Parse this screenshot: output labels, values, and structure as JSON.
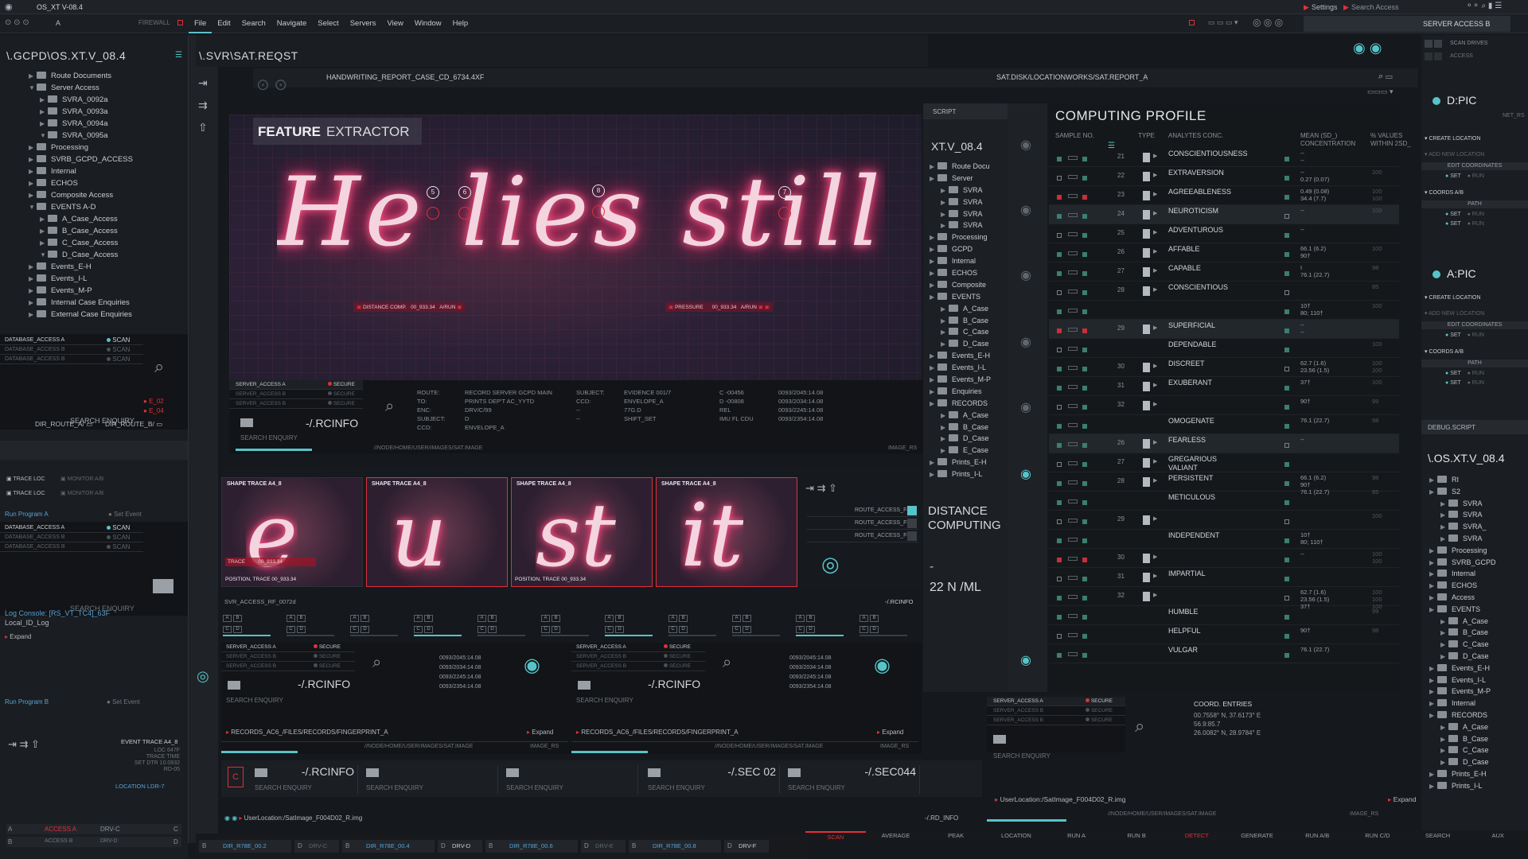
{
  "menubar": {
    "title": "OS_XT V-08.4",
    "firewall": "FIREWALL",
    "a_label": "A",
    "menus": [
      "File",
      "Edit",
      "Search",
      "Navigate",
      "Select",
      "Servers",
      "View",
      "Window",
      "Help"
    ],
    "settings": "Settings",
    "search_access": "Search Access",
    "server_access_b": "SERVER ACCESS B"
  },
  "left": {
    "path": "\\.GCPD\\OS.XT.V_08.4",
    "tree": [
      {
        "label": "Route Documents",
        "indent": 1,
        "open": false
      },
      {
        "label": "Server Access",
        "indent": 1,
        "open": true
      },
      {
        "label": "SVRA_0092a",
        "indent": 2,
        "open": false
      },
      {
        "label": "SVRA_0093a",
        "indent": 2,
        "open": false
      },
      {
        "label": "SVRA_0094a",
        "indent": 2,
        "open": false
      },
      {
        "label": "SVRA_0095a",
        "indent": 2,
        "open": true
      },
      {
        "label": "Processing",
        "indent": 1,
        "open": false
      },
      {
        "label": "SVRB_GCPD_ACCESS",
        "indent": 1,
        "open": false
      },
      {
        "label": "Internal",
        "indent": 1,
        "open": false
      },
      {
        "label": "ECHOS",
        "indent": 1,
        "open": false
      },
      {
        "label": "Composite Access",
        "indent": 1,
        "open": false
      },
      {
        "label": "EVENTS A-D",
        "indent": 1,
        "open": true
      },
      {
        "label": "A_Case_Access",
        "indent": 2,
        "open": false
      },
      {
        "label": "B_Case_Access",
        "indent": 2,
        "open": false
      },
      {
        "label": "C_Case_Access",
        "indent": 2,
        "open": false
      },
      {
        "label": "D_Case_Access",
        "indent": 2,
        "open": true
      },
      {
        "label": "Events_E-H",
        "indent": 1,
        "open": false
      },
      {
        "label": "Events_I-L",
        "indent": 1,
        "open": false
      },
      {
        "label": "Events_M-P",
        "indent": 1,
        "open": false
      },
      {
        "label": "Internal Case Enquiries",
        "indent": 1,
        "open": false
      },
      {
        "label": "External Case Enquiries",
        "indent": 1,
        "open": false
      }
    ],
    "db_rows": [
      "DATABASE_ACCESS A",
      "DATABASE_ACCESS B",
      "DATABASE_ACCESS B"
    ],
    "scan": "SCAN",
    "search_enquiry": "SEARCH ENQUIRY",
    "e02": "E_02",
    "e04": "E_04",
    "dir_route_a": "DIR_ROUTE_A/",
    "dir_route_b": "DIR_ROUTE_B/",
    "trace_loc": "TRACE LOC",
    "monitor_ab": "MONITOR A/B",
    "run_program_a": "Run Program A",
    "set_event": "Set Event",
    "log_console": "Log Console: [RS_VT_TC4]_63F",
    "local_log": "Local_ID_Log",
    "expand": "Expand",
    "run_program_b": "Run Program B",
    "event_trace": "EVENT TRACE A4_8",
    "event_meta": [
      "LOC 647F",
      "TRACE TIME",
      "SET DTR 10.0932",
      "RD-05"
    ],
    "location": "LOCATION LDR-7",
    "access_a": "ACCESS A",
    "access_b": "ACCESS B",
    "drv_c": "DRV-C",
    "drv_d": "DRV-D"
  },
  "main": {
    "path": "\\.SVR\\SAT.REQST",
    "file": "HANDWRITING_REPORT_CASE_CD_6734.4XF",
    "disk_path": "SAT.DISK/LOCATIONWORKS/SAT.REPORT_A",
    "feature_title_bold": "FEATURE",
    "feature_title_light": "EXTRACTOR",
    "handwriting": "He lies still",
    "markers": [
      "5",
      "6",
      "8",
      "7"
    ],
    "distance_comp": "DISTANCE COMP.",
    "distance_comp_val": "00_933.34",
    "pressure": "PRESSURE",
    "pressure_val": "00_933.34",
    "arun": "A/RUN",
    "server_access": [
      "SERVER_ACCESS A",
      "SERVER_ACCESS B",
      "SERVER_ACCESS B"
    ],
    "secure": "SECURE",
    "rcinfo": "-/.RCINFO",
    "search_enquiry": "SEARCH ENQUIRY",
    "record": {
      "route_k": "ROUTE:",
      "route_v": "RECORD SERVER GCPD MAIN",
      "to_k": "TO:",
      "to_v": "PRINTS DEP'T AC_YYTD",
      "enc_k": "ENC:",
      "enc_v": "DRV/C/99",
      "subj_k": "SUBJECT:",
      "subj_v": "D",
      "ccd_k": "CCD:",
      "ccd_v": "ENVELOPE_A",
      "subj2_k": "SUBJECT:",
      "subj2_v": "EVIDENCE 001/7",
      "ccd2_k": "CCD:",
      "ccd2_v": "ENVELOPE_A",
      "dash1": "--",
      "dash1v": "77G.D",
      "dash2": "--",
      "dash2v": "SHIFT_SET",
      "c1": "C  -00456",
      "c2": "D  -00808",
      "rel": "REL",
      "imu": "IMU FL CDU",
      "t1": "0093/2045:14.08",
      "t2": "0093/2034:14.08",
      "t3": "0093/2245:14.08",
      "t4": "0093/2354:14.08"
    },
    "node_path": "//NODE/HOME/USER/IMAGES/SAT.IMAGE",
    "image_rs": "IMAGE_RS",
    "shapes": [
      {
        "title": "SHAPE TRACE A4_8",
        "letter": "e"
      },
      {
        "title": "SHAPE TRACE A4_8",
        "letter": "u"
      },
      {
        "title": "SHAPE TRACE A4_8",
        "letter": "st"
      },
      {
        "title": "SHAPE TRACE A4_8",
        "letter": "it"
      }
    ],
    "trace": "TRACE",
    "trace_val": "00_933.34",
    "position_trace": "POSITION, TRACE",
    "route_access": [
      "ROUTE_ACCESS_F4",
      "ROUTE_ACCESS_F5",
      "ROUTE_ACCESS_F6"
    ],
    "svr_access_rf": "SVR_ACCESS_RF_0072d",
    "records_path": "RECORDS_AC6_/FILES/RECORDS/FINGERPRINT_A",
    "expand": "Expand",
    "times": [
      "0093/2045:14.08",
      "0093/2034:14.08",
      "0093/2245:14.08",
      "0093/2354:14.08"
    ],
    "sec02": "-/.SEC 02",
    "sec044": "-/.SEC044",
    "user_location": "UserLocation:/SatImage_F004D02_R.img",
    "rd_info": "-/.RD_INFO"
  },
  "script": {
    "label": "SCRIPT",
    "title": "XT.V_08.4",
    "tree": [
      {
        "label": "Route Docu",
        "indent": 0
      },
      {
        "label": "Server",
        "indent": 0
      },
      {
        "label": "SVRA",
        "indent": 1
      },
      {
        "label": "SVRA",
        "indent": 1
      },
      {
        "label": "SVRA",
        "indent": 1
      },
      {
        "label": "SVRA",
        "indent": 1
      },
      {
        "label": "Processing",
        "indent": 0
      },
      {
        "label": "GCPD",
        "indent": 0
      },
      {
        "label": "Internal",
        "indent": 0
      },
      {
        "label": "ECHOS",
        "indent": 0
      },
      {
        "label": "Composite",
        "indent": 0
      },
      {
        "label": "EVENTS",
        "indent": 0
      },
      {
        "label": "A_Case",
        "indent": 1
      },
      {
        "label": "B_Case",
        "indent": 1
      },
      {
        "label": "C_Case",
        "indent": 1
      },
      {
        "label": "D_Case",
        "indent": 1
      },
      {
        "label": "Events_E-H",
        "indent": 0
      },
      {
        "label": "Events_I-L",
        "indent": 0
      },
      {
        "label": "Events_M-P",
        "indent": 0
      },
      {
        "label": "Enquiries",
        "indent": 0
      },
      {
        "label": "RECORDS",
        "indent": 0
      },
      {
        "label": "A_Case",
        "indent": 1
      },
      {
        "label": "B_Case",
        "indent": 1
      },
      {
        "label": "D_Case",
        "indent": 1
      },
      {
        "label": "E_Case",
        "indent": 1
      },
      {
        "label": "Prints_E-H",
        "indent": 0
      },
      {
        "label": "Prints_I-L",
        "indent": 0
      }
    ],
    "distance_title": "DISTANCE COMPUTING",
    "dash": "-",
    "value": "22 N /ML"
  },
  "profile": {
    "title": "COMPUTING PROFILE",
    "headers": [
      "SAMPLE NO.",
      "TYPE",
      "ANALYTES CONC.",
      "MEAN (SD_) CONCENTRATION",
      "% VALUES WITHIN 2SD_"
    ],
    "rows": [
      {
        "no": "21",
        "name": "CONSCIENTIOUSNESS",
        "mean": "--\n--",
        "pct": ""
      },
      {
        "no": "22",
        "name": "EXTRAVERSION",
        "mean": "--\n0.27 (0.07)",
        "pct": "100"
      },
      {
        "no": "23",
        "name": "AGREEABLENESS",
        "mean": "0.49 (0.08)\n34.4 (7.7)",
        "pct": "100\n100"
      },
      {
        "no": "24",
        "name": "NEUROTICISM",
        "mean": "--",
        "pct": "100"
      },
      {
        "no": "25",
        "name": "ADVENTUROUS",
        "mean": "--",
        "pct": ""
      },
      {
        "no": "26",
        "name": "AFFABLE",
        "mean": "66.1 (6.2)\n90†",
        "pct": "100"
      },
      {
        "no": "27",
        "name": "CAPABLE",
        "mean": "I\n76.1 (22.7)",
        "pct": "98"
      },
      {
        "no": "28",
        "name": "CONSCIENTIOUS",
        "mean": "",
        "pct": "85"
      },
      {
        "no": "",
        "name": "",
        "mean": "10†\n80; 110†",
        "pct": "100"
      },
      {
        "no": "29",
        "name": "SUPERFICIAL",
        "mean": "--\n--",
        "pct": ""
      },
      {
        "no": "",
        "name": "DEPENDABLE",
        "mean": "",
        "pct": "100"
      },
      {
        "no": "30",
        "name": "DISCREET",
        "mean": "62.7 (1.6)\n23.56 (1.5)",
        "pct": "100\n100"
      },
      {
        "no": "31",
        "name": "EXUBERANT",
        "mean": "37†",
        "pct": "100"
      },
      {
        "no": "32",
        "name": "",
        "mean": "90†",
        "pct": "99"
      },
      {
        "no": "",
        "name": "OMOGENATE",
        "mean": "76.1 (22.7)",
        "pct": "98"
      },
      {
        "no": "26",
        "name": "FEARLESS",
        "mean": "--",
        "pct": ""
      },
      {
        "no": "27",
        "name": "GREGARIOUS\nVALIANT",
        "mean": "",
        "pct": ""
      },
      {
        "no": "28",
        "name": "PERSISTENT",
        "mean": "66.1 (6.2)\n90†\n76.1 (22.7)",
        "pct": "98\n\n85"
      },
      {
        "no": "",
        "name": "METICULOUS",
        "mean": "",
        "pct": ""
      },
      {
        "no": "29",
        "name": "",
        "mean": "",
        "pct": "100"
      },
      {
        "no": "",
        "name": "INDEPENDENT",
        "mean": "10†\n80; 110†",
        "pct": ""
      },
      {
        "no": "30",
        "name": "",
        "mean": "--",
        "pct": "100\n100"
      },
      {
        "no": "31",
        "name": "IMPARTIAL",
        "mean": "",
        "pct": ""
      },
      {
        "no": "32",
        "name": "",
        "mean": "62.7 (1.6)\n23.56 (1.5)\n37†",
        "pct": "100\n100\n100"
      },
      {
        "no": "",
        "name": "HUMBLE",
        "mean": "",
        "pct": "99"
      },
      {
        "no": "",
        "name": "HELPFUL",
        "mean": "90†",
        "pct": "98"
      },
      {
        "no": "",
        "name": "VULGAR",
        "mean": "76.1 (22.7)",
        "pct": ""
      }
    ],
    "server_access": [
      "SERVER_ACCESS A",
      "SERVER_ACCESS B",
      "SERVER_ACCESS B"
    ],
    "secure": "SECURE",
    "search_enquiry": "SEARCH ENQUIRY",
    "coord_title": "COORD. ENTRIES",
    "coords": [
      "00.7558° N, 37.6173° E",
      "56.9:85.7",
      "26.0082° N, 28.9784° E"
    ],
    "user_location": "UserLocation:/SatImage_F004D02_R.img",
    "expand": "Expand",
    "node_path": "//NODE/HOME/USER/IMAGES/SAT.IMAGE",
    "image_rs": "IMAGE_RS"
  },
  "right": {
    "scan_drives": "SCAN DRIVES",
    "access": "ACCESS",
    "dpic": "D:PIC",
    "net": "NET_RS",
    "create_location": "CREATE LOCATION",
    "add_new_location": "ADD NEW LOCATION",
    "edit_coordinates": "EDIT COORDINATES",
    "set": "SET",
    "run": "RUN",
    "coords_ab": "COORDS A/B",
    "path": "PATH",
    "apic": "A:PIC",
    "debug_script": "DEBUG.SCRIPT",
    "os_title": "\\.OS.XT.V_08.4",
    "tree": [
      {
        "label": "RI",
        "indent": 0
      },
      {
        "label": "S2",
        "indent": 0
      },
      {
        "label": "SVRA",
        "indent": 1
      },
      {
        "label": "SVRA",
        "indent": 1
      },
      {
        "label": "SVRA_",
        "indent": 1
      },
      {
        "label": "SVRA",
        "indent": 1
      },
      {
        "label": "Processing",
        "indent": 0
      },
      {
        "label": "SVRB_GCPD",
        "indent": 0
      },
      {
        "label": "Internal",
        "indent": 0
      },
      {
        "label": "ECHOS",
        "indent": 0
      },
      {
        "label": "Access",
        "indent": 0
      },
      {
        "label": "EVENTS",
        "indent": 0
      },
      {
        "label": "A_Case",
        "indent": 1
      },
      {
        "label": "B_Case",
        "indent": 1
      },
      {
        "label": "C_Case",
        "indent": 1
      },
      {
        "label": "D_Case",
        "indent": 1
      },
      {
        "label": "Events_E-H",
        "indent": 0
      },
      {
        "label": "Events_I-L",
        "indent": 0
      },
      {
        "label": "Events_M-P",
        "indent": 0
      },
      {
        "label": "Internal",
        "indent": 0
      },
      {
        "label": "RECORDS",
        "indent": 0
      },
      {
        "label": "A_Case",
        "indent": 1
      },
      {
        "label": "B_Case",
        "indent": 1
      },
      {
        "label": "C_Case",
        "indent": 1
      },
      {
        "label": "D_Case",
        "indent": 1
      },
      {
        "label": "Prints_E-H",
        "indent": 0
      },
      {
        "label": "Prints_I-L",
        "indent": 0
      }
    ]
  },
  "bottom": {
    "dirs": [
      "DIR_R78E_00.2",
      "DRV-C",
      "DIR_R78E_00.4",
      "DRV-D",
      "DIR_R78E_00.6",
      "DRV-E",
      "DIR_R78E_00.8",
      "DRV-F"
    ],
    "tabs": [
      "SCAN",
      "AVERAGE",
      "PEAK",
      "LOCATION",
      "RUN A",
      "RUN B",
      "DETECT",
      "GENERATE",
      "RUN A/B",
      "RUN C/D",
      "SEARCH",
      "AUX"
    ]
  }
}
